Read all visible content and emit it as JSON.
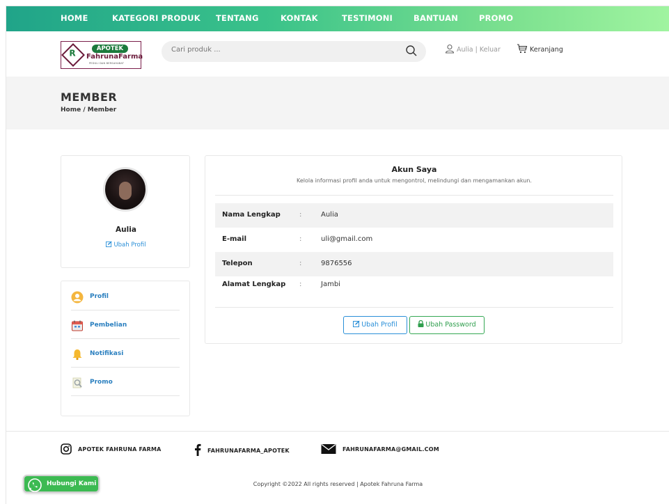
{
  "nav": {
    "items": [
      "HOME",
      "KATEGORI PRODUK",
      "TENTANG",
      "KONTAK",
      "TESTIMONI",
      "BANTUAN",
      "PROMO"
    ]
  },
  "header": {
    "logo": {
      "pill": "APOTEK",
      "brand": "FahrunaFarma",
      "tagline": "PEDULI DAN BERSAHABAT"
    },
    "search_placeholder": "Cari produk ...",
    "user_link": "Aulia | Keluar",
    "cart_label": "Keranjang"
  },
  "banner": {
    "title": "MEMBER",
    "breadcrumb": "Home / Member"
  },
  "profile": {
    "name": "Aulia",
    "edit_label": "Ubah Profil"
  },
  "menu": {
    "items": [
      {
        "label": "Profil",
        "icon": "user-icon"
      },
      {
        "label": "Pembelian",
        "icon": "calendar-icon"
      },
      {
        "label": "Notifikasi",
        "icon": "bell-icon"
      },
      {
        "label": "Promo",
        "icon": "promo-icon"
      }
    ]
  },
  "account": {
    "title": "Akun Saya",
    "subtitle": "Kelola informasi profil anda untuk mengontrol, melindungi dan mengamankan akun.",
    "rows": [
      {
        "label": "Nama Lengkap",
        "sep": ":",
        "value": "Aulia"
      },
      {
        "label": "E-mail",
        "sep": ":",
        "value": "uli@gmail.com"
      },
      {
        "label": "Telepon",
        "sep": ":",
        "value": "9876556"
      },
      {
        "label": "Alamat Lengkap",
        "sep": ":",
        "value": "Jambi"
      }
    ],
    "edit_profile_button": "Ubah Profil",
    "edit_password_button": "Ubah Password"
  },
  "footer": {
    "instagram": "APOTEK FAHRUNA FARMA",
    "facebook": "FAHRUNAFARMA_APOTEK",
    "email": "FAHRUNAFARMA@GMAIL.COM",
    "copyright": "Copyright ©2022 All rights reserved | Apotek Fahruna Farma",
    "whatsapp_label": "Hubungi Kami"
  },
  "colors": {
    "nav_gradient_start": "#20a489",
    "nav_gradient_end": "#a0f4a0",
    "link_blue": "#2a8fd8",
    "button_green": "#34a853",
    "whatsapp_green": "#3cba52"
  }
}
